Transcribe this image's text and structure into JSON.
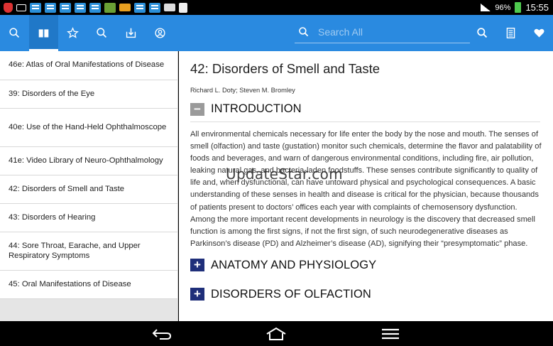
{
  "status_bar": {
    "battery": "96%",
    "time": "15:55",
    "left_icons": [
      "shield-icon",
      "mail-icon",
      "app-icon",
      "app-icon",
      "app-icon",
      "app-icon",
      "app-icon",
      "x-icon",
      "folder-icon",
      "app-icon",
      "app-icon",
      "photo-icon",
      "clipboard-icon"
    ],
    "battery_color": "#4ec94e"
  },
  "toolbar": {
    "color": "#2a8ae0",
    "left_icons": [
      "search-icon",
      "book-icon",
      "star-icon",
      "search-icon",
      "download-icon",
      "user-icon"
    ],
    "search_placeholder": "Search All",
    "right_icons": [
      "search-icon",
      "document-icon",
      "heart-icon"
    ]
  },
  "sidebar": {
    "items": [
      {
        "label": "46e:  Atlas of Oral Manifestations of Disease"
      },
      {
        "label": "39:  Disorders of the Eye"
      },
      {
        "label": "40e:  Use of the Hand-Held Ophthalmoscope"
      },
      {
        "label": "41e:  Video Library of Neuro-Ophthalmology"
      },
      {
        "label": "42:  Disorders of Smell and Taste"
      },
      {
        "label": "43:  Disorders of Hearing"
      },
      {
        "label": "44:  Sore Throat, Earache, and Upper Respiratory Symptoms"
      },
      {
        "label": "45:  Oral Manifestations of Disease"
      }
    ]
  },
  "content": {
    "chapter_title": "42: Disorders of Smell and Taste",
    "authors": "Richard L. Doty; Steven M. Bromley",
    "sections": [
      {
        "title": "INTRODUCTION",
        "expanded": true,
        "toggle": "−"
      },
      {
        "title": "ANATOMY AND PHYSIOLOGY",
        "expanded": false,
        "toggle": "+"
      },
      {
        "title": "DISORDERS OF OLFACTION",
        "expanded": false,
        "toggle": "+"
      }
    ],
    "intro_paragraph": "All environmental chemicals necessary for life enter the body by the nose and mouth. The senses of smell (olfaction) and taste (gustation) monitor such chemicals, determine the flavor and palatability of foods and beverages, and warn of dangerous environmental conditions, including fire, air pollution, leaking natural gas, and bacteria-laden foodstuffs. These senses contribute significantly to quality of life and, when dysfunctional, can have untoward physical and psychological consequences. A basic understanding of these senses in health and disease is critical for the physician, because thousands of patients present to doctors’ offices each year with complaints of chemosensory dysfunction. Among the more important recent developments in neurology is the discovery that decreased smell function is among the first signs, if not the first sign, of such neurodegenerative diseases as Parkinson’s disease (PD) and Alzheimer’s disease (AD), signifying their “presymptomatic” phase."
  },
  "watermark": "UpdateStar.com",
  "nav_bar": {
    "icons": [
      "back-icon",
      "home-icon",
      "menu-icon"
    ]
  }
}
